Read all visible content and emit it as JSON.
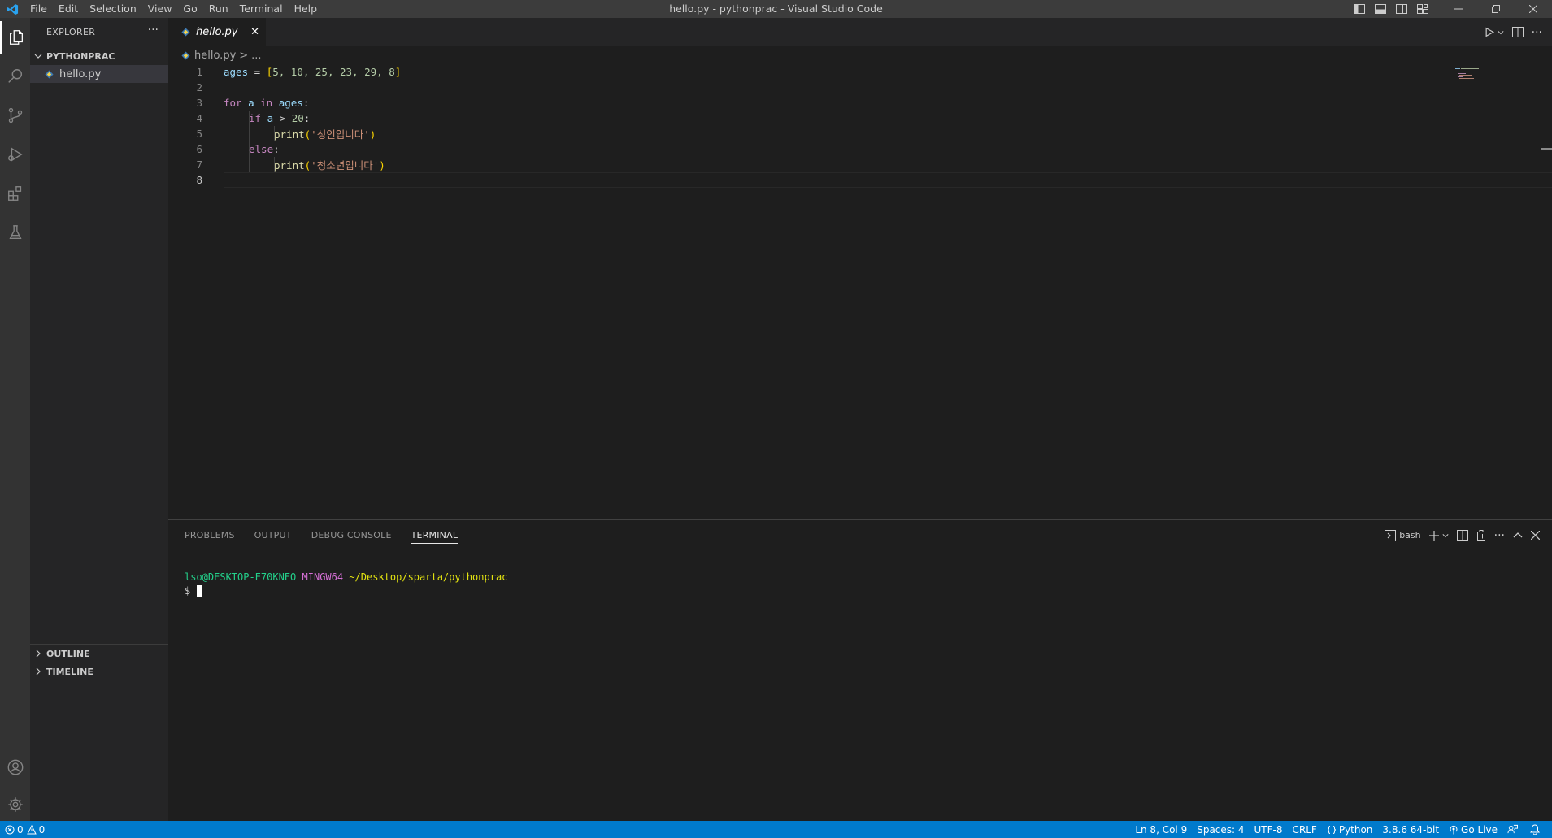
{
  "titlebar": {
    "title": "hello.py - pythonprac - Visual Studio Code",
    "menu": [
      "File",
      "Edit",
      "Selection",
      "View",
      "Go",
      "Run",
      "Terminal",
      "Help"
    ]
  },
  "sidebar": {
    "header": "EXPLORER",
    "more": "···",
    "folder": "PYTHONPRAC",
    "files": [
      "hello.py"
    ],
    "outline": "OUTLINE",
    "timeline": "TIMELINE"
  },
  "tab": {
    "label": "hello.py",
    "close": "✕"
  },
  "breadcrumb": {
    "file": "hello.py",
    "sep": ">",
    "rest": "..."
  },
  "editor": {
    "line_numbers": [
      "1",
      "2",
      "3",
      "4",
      "5",
      "6",
      "7",
      "8"
    ],
    "line1": {
      "var": "ages",
      "op": " = ",
      "lb": "[",
      "nums": "5, 10, 25, 23, 29, 8",
      "rb": "]"
    },
    "line3": {
      "kw1": "for",
      "v1": " a ",
      "kw2": "in",
      "v2": " ages",
      "colon": ":"
    },
    "line4": {
      "kw": "if",
      "v": " a ",
      "op": "> ",
      "num": "20",
      "colon": ":"
    },
    "line5": {
      "fn": "print",
      "lp": "(",
      "str": "'성인입니다'",
      "rp": ")"
    },
    "line6": {
      "kw": "else",
      "colon": ":"
    },
    "line7": {
      "fn": "print",
      "lp": "(",
      "str": "'청소년입니다'",
      "rp": ")"
    }
  },
  "panel": {
    "tabs": [
      "PROBLEMS",
      "OUTPUT",
      "DEBUG CONSOLE",
      "TERMINAL"
    ],
    "active_tab": "TERMINAL",
    "shell": "bash",
    "terminal": {
      "user": "lso@DESKTOP-E70KNEO",
      "env": "MINGW64",
      "path": "~/Desktop/sparta/pythonprac",
      "prompt": "$"
    }
  },
  "statusbar": {
    "errors": "0",
    "warnings": "0",
    "position": "Ln 8, Col 9",
    "spaces": "Spaces: 4",
    "encoding": "UTF-8",
    "eol": "CRLF",
    "language": "Python",
    "interpreter": "3.8.6 64-bit",
    "golive": "Go Live"
  },
  "colors": {
    "accent": "#007acc",
    "keyword": "#c586c0",
    "variable": "#9cdcfe",
    "number": "#b5cea8",
    "string": "#ce9178",
    "function": "#dcdcaa"
  }
}
